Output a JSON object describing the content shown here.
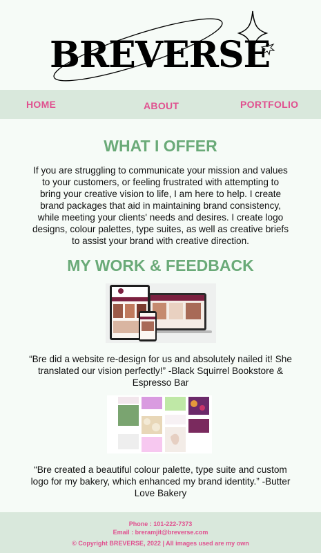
{
  "brand": {
    "logo_text": "BREVERSE"
  },
  "nav": {
    "home": "HOME",
    "about": "ABOUT",
    "portfolio": "PORTFOLIO"
  },
  "offer": {
    "title": "WHAT I OFFER",
    "text": "If you are struggling to communicate your mission and values to your customers, or feeling frustrated with attempting to bring your creative vision to life, I am here to help. I create brand packages that aid in maintaining brand consistency, while meeting your clients' needs and desires. I create logo designs, colour palettes, type suites, as well as creative briefs to assist your brand with creative direction."
  },
  "work": {
    "title": "MY WORK & FEEDBACK",
    "quote1": "“Bre did a website re-design for us and absolutely nailed it! She translated our vision perfectly!” -Black Squirrel Bookstore & Espresso Bar",
    "quote2": "“Bre created a beautiful colour palette, type suite and custom logo for my bakery, which enhanced my brand identity.” -Butter Love Bakery"
  },
  "footer": {
    "phone": "Phone : 101-222-7373",
    "email": "Email : breramjit@breverse.com",
    "copyright": "© Copyright BREVERSE, 2022 | All images used are my own"
  },
  "colors": {
    "accent_pink": "#e0508f",
    "accent_green": "#6aaa78",
    "band": "#d9e8dc"
  }
}
